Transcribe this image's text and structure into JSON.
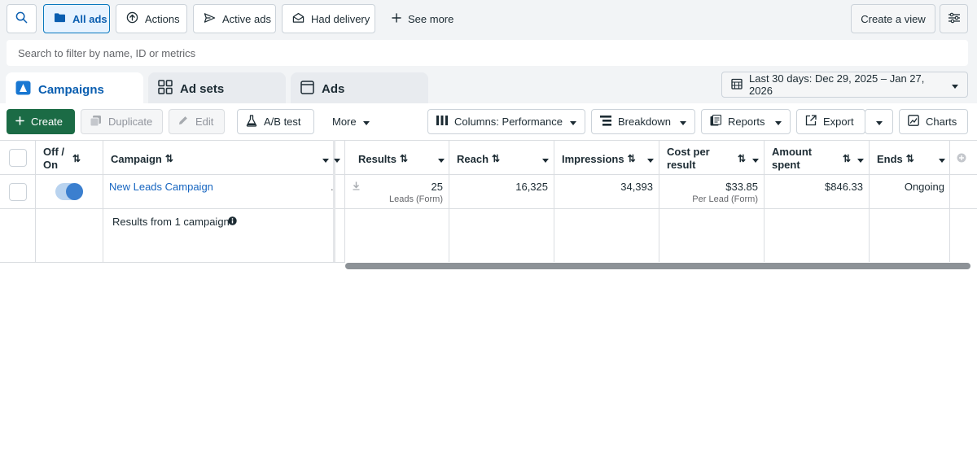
{
  "toolbar": {
    "search_icon": "search-icon",
    "all_ads": "All ads",
    "actions": "Actions",
    "active_ads": "Active ads",
    "had_delivery": "Had delivery",
    "see_more": "See more",
    "create_view": "Create a view"
  },
  "search": {
    "placeholder": "Search to filter by name, ID or metrics"
  },
  "tabs": [
    {
      "label": "Campaigns"
    },
    {
      "label": "Ad sets"
    },
    {
      "label": "Ads"
    }
  ],
  "date_range": "Last 30 days: Dec 29, 2025 – Jan 27, 2026",
  "actions_bar": {
    "create": "Create",
    "duplicate": "Duplicate",
    "edit": "Edit",
    "ab_test": "A/B test",
    "more": "More",
    "columns": "Columns: Performance",
    "breakdown": "Breakdown",
    "reports": "Reports",
    "export": "Export",
    "charts": "Charts"
  },
  "table": {
    "headers": {
      "off_on_1": "Off /",
      "off_on_2": "On",
      "campaign": "Campaign",
      "results": "Results",
      "reach": "Reach",
      "impressions": "Impressions",
      "cost_per_result_1": "Cost per",
      "cost_per_result_2": "result",
      "amount_spent_1": "Amount",
      "amount_spent_2": "spent",
      "ends": "Ends"
    },
    "rows": [
      {
        "campaign": "New Leads Campaign",
        "results": "25",
        "results_sub": "Leads (Form)",
        "reach": "16,325",
        "impressions": "34,393",
        "cost_per_result": "$33.85",
        "cost_per_result_sub": "Per Lead (Form)",
        "amount_spent": "$846.33",
        "ends": "Ongoing",
        "toggle_on": true
      }
    ],
    "summary": "Results from 1 campaign"
  },
  "colors": {
    "accent": "#0a78be",
    "create_button": "#1b6b45",
    "link": "#1665c0"
  }
}
